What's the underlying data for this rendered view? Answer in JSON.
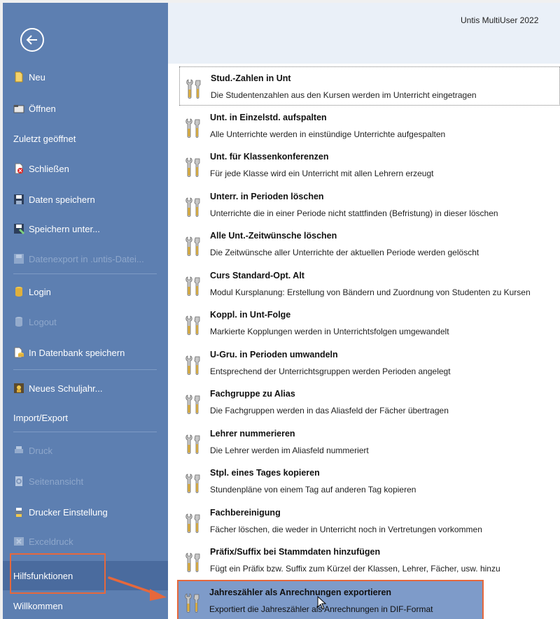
{
  "window": {
    "title": "Untis MultiUser 2022"
  },
  "sidebar": {
    "items": [
      {
        "label": "Neu",
        "icon": "new-document-icon",
        "disabled": false
      },
      {
        "label": "Öffnen",
        "icon": "folder-open-icon",
        "disabled": false
      },
      {
        "label": "Zuletzt geöffnet",
        "icon": "",
        "disabled": false
      },
      {
        "label": "Schließen",
        "icon": "close-file-icon",
        "disabled": false
      },
      {
        "label": "Daten speichern",
        "icon": "save-icon",
        "disabled": false
      },
      {
        "label": "Speichern unter...",
        "icon": "save-as-icon",
        "disabled": false
      },
      {
        "label": "Datenexport in .untis-Datei...",
        "icon": "export-icon",
        "disabled": true
      },
      {
        "label": "Login",
        "icon": "database-login-icon",
        "disabled": false
      },
      {
        "label": "Logout",
        "icon": "database-logout-icon",
        "disabled": true
      },
      {
        "label": "In Datenbank speichern",
        "icon": "database-save-icon",
        "disabled": false
      },
      {
        "label": "Neues Schuljahr...",
        "icon": "new-schoolyear-icon",
        "disabled": false
      },
      {
        "label": "Import/Export",
        "icon": "",
        "disabled": false
      },
      {
        "label": "Druck",
        "icon": "print-icon",
        "disabled": true
      },
      {
        "label": "Seitenansicht",
        "icon": "print-preview-icon",
        "disabled": true
      },
      {
        "label": "Drucker Einstellung",
        "icon": "printer-settings-icon",
        "disabled": false
      },
      {
        "label": "Exceldruck",
        "icon": "excel-icon",
        "disabled": true
      },
      {
        "label": "Hilfsfunktionen",
        "icon": "",
        "disabled": false,
        "selected": true
      },
      {
        "label": "Willkommen",
        "icon": "",
        "disabled": false
      }
    ]
  },
  "functions": [
    {
      "title": "Stud.-Zahlen in Unt",
      "desc": "Die Studentenzahlen aus den Kursen werden im Unterricht eingetragen",
      "icon": "tools-icon"
    },
    {
      "title": "Unt. in Einzelstd. aufspalten",
      "desc": "Alle Unterrichte werden in einstündige Unterrichte aufgespalten",
      "icon": "tools-icon"
    },
    {
      "title": "Unt. für Klassenkonferenzen",
      "desc": "Für jede Klasse wird ein Unterricht mit allen Lehrern erzeugt",
      "icon": "tools-icon"
    },
    {
      "title": "Unterr. in Perioden löschen",
      "desc": "Unterrichte die in einer Periode nicht stattfinden (Befristung) in dieser löschen",
      "icon": "tools-icon"
    },
    {
      "title": "Alle Unt.-Zeitwünsche löschen",
      "desc": "Die Zeitwünsche aller Unterrichte der aktuellen Periode werden gelöscht",
      "icon": "tools-icon"
    },
    {
      "title": "Curs Standard-Opt. Alt",
      "desc": "Modul Kursplanung: Erstellung von Bändern und Zuordnung von Studenten zu Kursen",
      "icon": "tools-icon"
    },
    {
      "title": "Koppl. in Unt-Folge",
      "desc": "Markierte Kopplungen werden in Unterrichtsfolgen umgewandelt",
      "icon": "tools-icon"
    },
    {
      "title": "U-Gru. in Perioden umwandeln",
      "desc": "Entsprechend der Unterrichtsgruppen werden Perioden angelegt",
      "icon": "tools-icon"
    },
    {
      "title": "Fachgruppe zu Alias",
      "desc": "Die Fachgruppen werden in das Aliasfeld der Fächer übertragen",
      "icon": "tools-icon"
    },
    {
      "title": "Lehrer nummerieren",
      "desc": "Die Lehrer werden im Aliasfeld nummeriert",
      "icon": "tools-icon"
    },
    {
      "title": "Stpl. eines Tages kopieren",
      "desc": "Stundenpläne von einem Tag auf anderen Tag kopieren",
      "icon": "tools-icon"
    },
    {
      "title": "Fachbereinigung",
      "desc": "Fächer löschen, die weder in Unterricht noch in Vertretungen vorkommen",
      "icon": "tools-icon"
    },
    {
      "title": "Präfix/Suffix bei Stammdaten hinzufügen",
      "desc": "Fügt ein Präfix bzw. Suffix zum Kürzel der Klassen, Lehrer, Fächer, usw. hinzu",
      "icon": "tools-icon"
    },
    {
      "title": "Jahreszähler als Anrechnungen exportieren",
      "desc": "Exportiert die Jahreszähler als Anrechnungen in DIF-Format",
      "icon": "tools-icon",
      "selected": true
    }
  ],
  "colors": {
    "sidebar": "#5d7fb1",
    "selected_row": "#7e9bc9",
    "highlight": "#e6683c"
  }
}
